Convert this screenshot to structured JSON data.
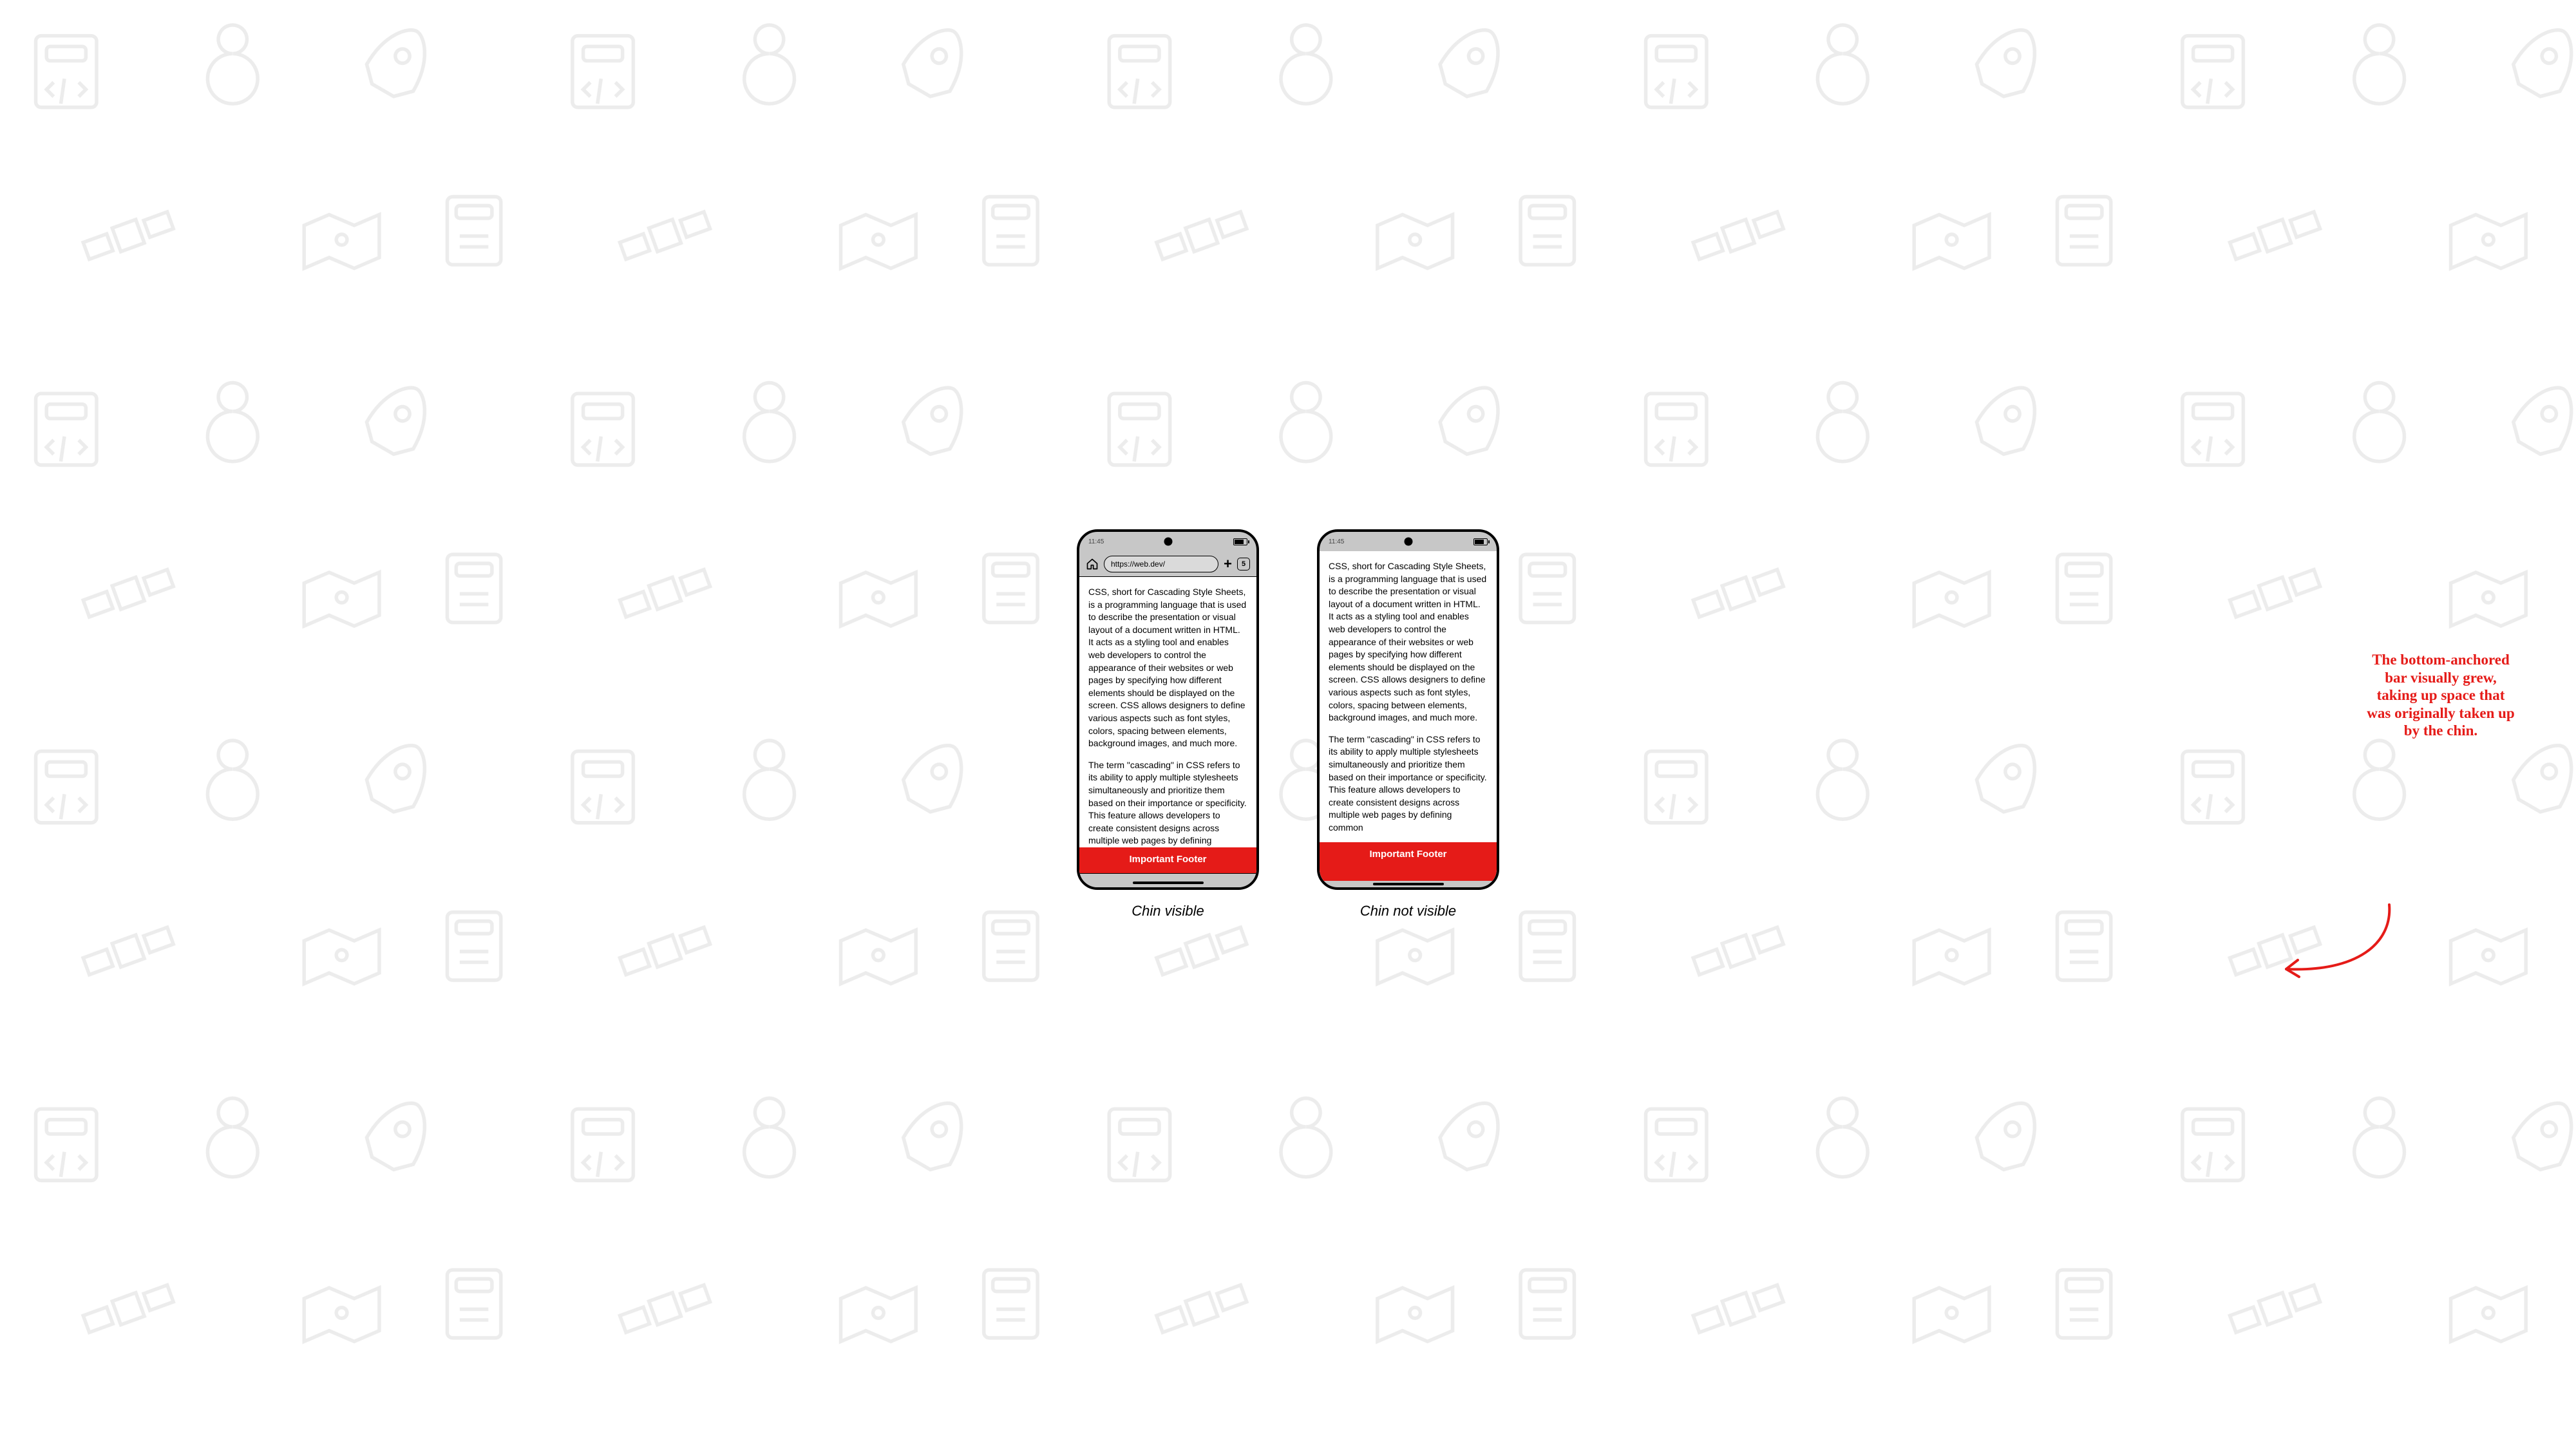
{
  "status": {
    "time": "11:45"
  },
  "browser": {
    "url": "https://web.dev/",
    "tab_count": "5"
  },
  "body": {
    "p1": "CSS, short for Cascading Style Sheets, is a programming language that is used to describe the presentation or visual layout of a document written in HTML. It acts as a styling tool and enables web developers to control the appearance of their websites or web pages by specifying how different elements should be displayed on the screen. CSS allows designers to define various aspects such as font styles, colors, spacing between elements, background images, and much more.",
    "p2": "The term \"cascading\" in CSS refers to its ability to apply multiple stylesheets simultaneously and prioritize them based on their importance or specificity. This feature allows developers to create consistent designs across multiple web pages by defining common"
  },
  "footer": {
    "label": "Important Footer"
  },
  "captions": {
    "a": "Chin visible",
    "b": "Chin not visible"
  },
  "note": "The bottom-anchored bar visually grew, taking up space that was originally taken up by the chin."
}
